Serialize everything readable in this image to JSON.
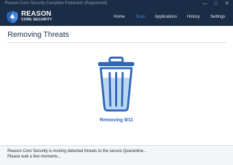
{
  "window": {
    "title": "Reason Core Security Complete Protection (Registered)",
    "controls": {
      "minimize": "—",
      "maximize": "□",
      "close": "✕"
    }
  },
  "brand": {
    "name": "REASON",
    "subtitle": "CORE SECURITY",
    "logo_icon": "shield-icon"
  },
  "nav": {
    "home": "Home",
    "scan": "Scan",
    "applications": "Applications",
    "history": "History",
    "settings": "Settings",
    "active": "scan"
  },
  "main": {
    "title": "Removing Threats",
    "progress_label": "Removing 8/11",
    "progress": {
      "current": 8,
      "total": 11
    },
    "icon": "trash-icon"
  },
  "footer": {
    "line1": "Reason Core Security is moving detected threats to the secure Quarantine...",
    "line2": "Please wait a few moments..."
  },
  "colors": {
    "header_bg": "#1b2c47",
    "accent": "#2f67b9",
    "nav_active": "#3d8fe0",
    "trash_fill": "#bcd7f3"
  }
}
